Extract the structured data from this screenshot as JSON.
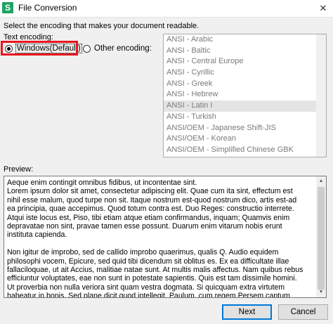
{
  "window": {
    "title": "File Conversion",
    "app_icon_glyph": "S",
    "close_glyph": "✕"
  },
  "instruction": "Select the encoding that makes your document readable.",
  "encoding": {
    "label": "Text encoding:",
    "option_windows": "Windows(Default)",
    "option_other": "Other encoding:",
    "selected": "Windows(Default)",
    "list": [
      "ANSI - Arabic",
      "ANSI - Baltic",
      "ANSI - Central Europe",
      "ANSI - Cyrillic",
      "ANSI - Greek",
      "ANSI - Hebrew",
      "ANSI - Latin I",
      "ANSI - Turkish",
      "ANSI/OEM - Japanese Shift-JIS",
      "ANSI/OEM - Korean",
      "ANSI/OEM - Simplified Chinese GBK"
    ],
    "list_selected": "ANSI - Latin I"
  },
  "preview": {
    "label": "Preview:",
    "text": "Aeque enim contingit omnibus fidibus, ut incontentae sint.\nLorem ipsum dolor sit amet, consectetur adipiscing elit. Quae cum ita sint, effectum est\nnihil esse malum, quod turpe non sit. Itaque nostrum est-quod nostrum dico, artis est-ad\nea principia, quae accepimus. Quod totum contra est. Duo Reges: constructio interrete.\nAtqui iste locus est, Piso, tibi etiam atque etiam confirmandus, inquam; Quamvis enim\ndepravatae non sint, pravae tamen esse possunt. Duarum enim vitarum nobis erunt\ninstituta capienda.\n\nNon igitur de improbo, sed de callido improbo quaerimus, qualis Q. Audio equidem\nphilosophi vocem, Epicure, sed quid tibi dicendum sit oblitus es. Ex ea difficultate illae\nfallaciloquae, ut ait Accius, malitiae natae sunt. At multis malis affectus. Nam quibus rebus\nefficiuntur voluptates, eae non sunt in potestate sapientis. Quis est tam dissimile homini.\nUt proverbia non nulla veriora sint quam vestra dogmata. Si quicquam extra virtutem\nhabeatur in bonis. Sed plane dicit quod intellegit. Paulum, cum regem Persem captum"
  },
  "buttons": {
    "next": "Next",
    "cancel": "Cancel"
  },
  "colors": {
    "highlight": "#e8141e",
    "default_button_border": "#0078d7",
    "app_icon": "#1fa463"
  },
  "icons": {
    "app": "app-logo-icon",
    "close": "close-icon"
  }
}
